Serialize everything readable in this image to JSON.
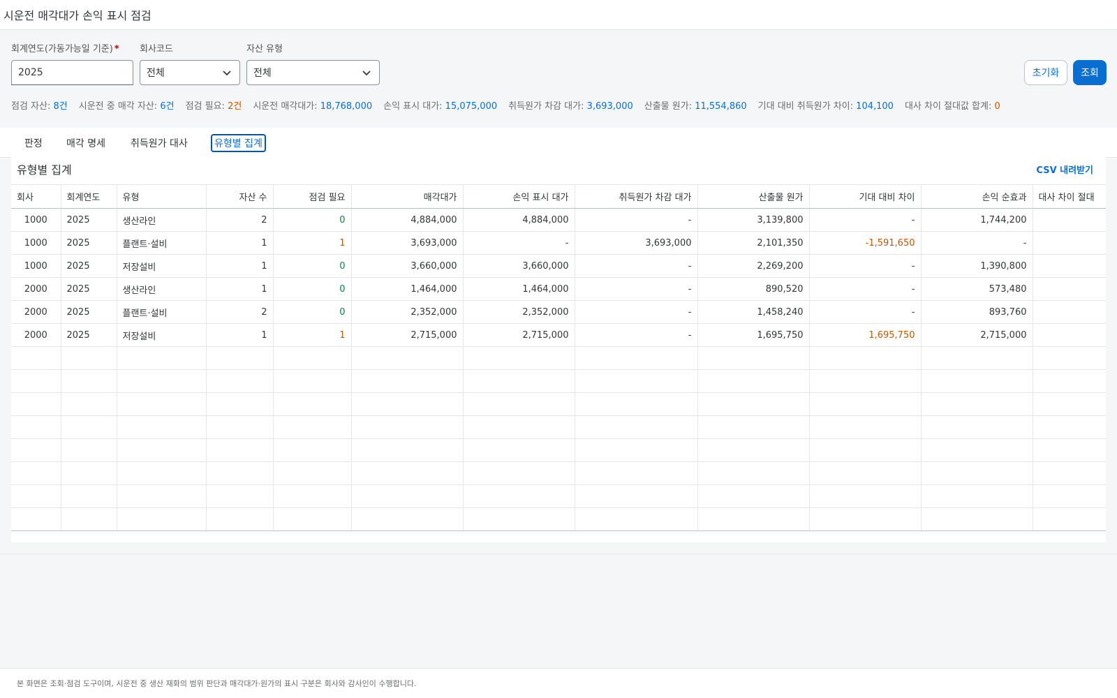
{
  "title": "시운전 매각대가 손익 표시 점검",
  "filters": {
    "year_label": "회계연도(가동가능일 기준)",
    "year_required": "*",
    "year_value": "2025",
    "company_label": "회사코드",
    "company_value": "전체",
    "asset_type_label": "자산 유형",
    "asset_type_value": "전체",
    "reset_label": "초기화",
    "search_label": "조회"
  },
  "summary": [
    {
      "label": "점검 자산:",
      "value": "8건"
    },
    {
      "label": "시운전 중 매각 자산:",
      "value": "6건"
    },
    {
      "label": "점검 필요:",
      "value": "2건"
    },
    {
      "label": "시운전 매각대가:",
      "value": "18,768,000"
    },
    {
      "label": "손익 표시 대가:",
      "value": "15,075,000"
    },
    {
      "label": "취득원가 차감 대가:",
      "value": "3,693,000"
    },
    {
      "label": "산출물 원가:",
      "value": "11,554,860"
    },
    {
      "label": "기대 대비 취득원가 차이:",
      "value": "104,100"
    },
    {
      "label": "대사 차이 절대값 합계:",
      "value": "0"
    }
  ],
  "colors": {
    "accent": "#0a6ed1",
    "warn": "#c35500",
    "ok": "#107e3e"
  },
  "tabs": [
    {
      "label": "판정"
    },
    {
      "label": "매각 명세"
    },
    {
      "label": "취득원가 대사"
    },
    {
      "label": "유형별 집계"
    }
  ],
  "active_tab": "유형별 집계",
  "card": {
    "title": "유형별 집계",
    "csv_label": "CSV 내려받기"
  },
  "table": {
    "headers": [
      "회사",
      "회계연도",
      "유형",
      "자산 수",
      "점검 필요",
      "매각대가",
      "손익 표시 대가",
      "취득원가 차감 대가",
      "산출물 원가",
      "기대 대비 차이",
      "손익 순효과",
      "대사 차이 절대"
    ],
    "rows": [
      [
        "1000",
        "2025",
        "생산라인",
        "2",
        "0",
        "4,884,000",
        "4,884,000",
        "-",
        "3,139,800",
        "-",
        "1,744,200",
        ""
      ],
      [
        "1000",
        "2025",
        "플랜트·설비",
        "1",
        "1",
        "3,693,000",
        "-",
        "3,693,000",
        "2,101,350",
        "-1,591,650",
        "-",
        ""
      ],
      [
        "1000",
        "2025",
        "저장설비",
        "1",
        "0",
        "3,660,000",
        "3,660,000",
        "-",
        "2,269,200",
        "-",
        "1,390,800",
        ""
      ],
      [
        "2000",
        "2025",
        "생산라인",
        "1",
        "0",
        "1,464,000",
        "1,464,000",
        "-",
        "890,520",
        "-",
        "573,480",
        ""
      ],
      [
        "2000",
        "2025",
        "플랜트·설비",
        "2",
        "0",
        "2,352,000",
        "2,352,000",
        "-",
        "1,458,240",
        "-",
        "893,760",
        ""
      ],
      [
        "2000",
        "2025",
        "저장설비",
        "1",
        "1",
        "2,715,000",
        "2,715,000",
        "-",
        "1,695,750",
        "1,695,750",
        "2,715,000",
        ""
      ]
    ]
  },
  "footer": "본 화면은 조회·점검 도구이며, 시운전 중 생산 재화의 범위 판단과 매각대가·원가의 표시 구분은 회사와 감사인이 수행합니다."
}
